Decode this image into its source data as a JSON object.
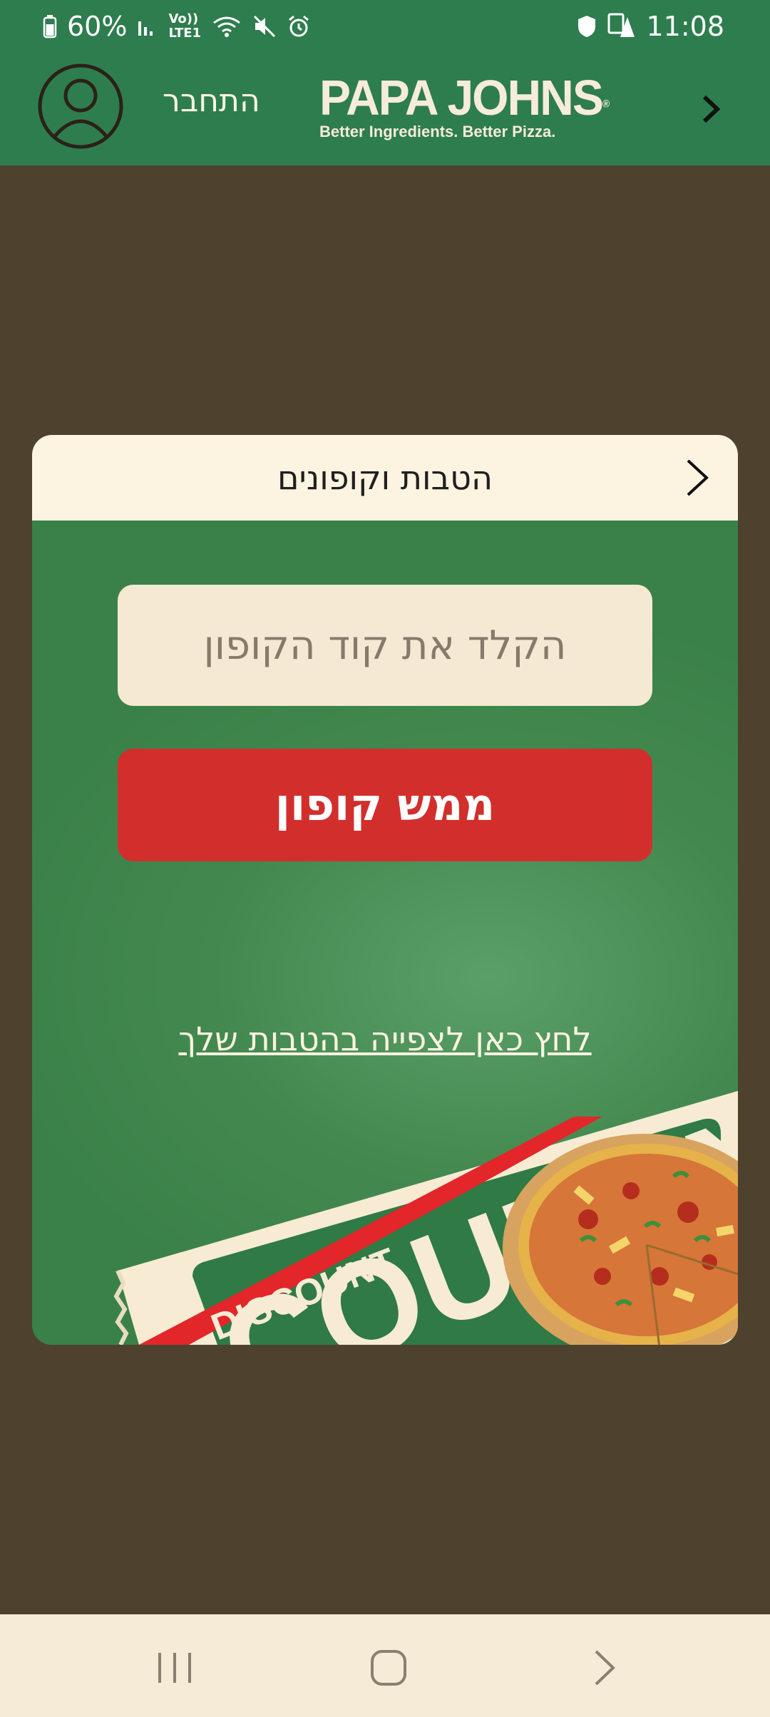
{
  "status_bar": {
    "battery_percent": "60%",
    "network_top": "Vo))",
    "network_bottom": "LTE1",
    "time": "11:08"
  },
  "header": {
    "login_label": "התחבר",
    "logo_text": "PAPA JOHNS",
    "logo_reg": "®",
    "logo_tagline": "Better Ingredients. Better Pizza."
  },
  "modal": {
    "title": "הטבות וקופונים",
    "coupon_placeholder": "הקלד את קוד הקופון",
    "redeem_button": "ממש קופון",
    "benefits_link": "לחץ כאן לצפייה בהטבות שלך",
    "coupon_banner_text": "DISCOUNT",
    "coupon_big_text": "COUPON"
  },
  "colors": {
    "brand_green": "#2e7d4e",
    "cream": "#fdf3e1",
    "accent_red": "#d22f2c",
    "backdrop": "#4e422e"
  },
  "icons": {
    "avatar": "user-circle-icon",
    "back": "chevron-right-icon",
    "nav_recents": "recents-icon",
    "nav_home": "home-icon",
    "nav_back": "back-icon"
  }
}
